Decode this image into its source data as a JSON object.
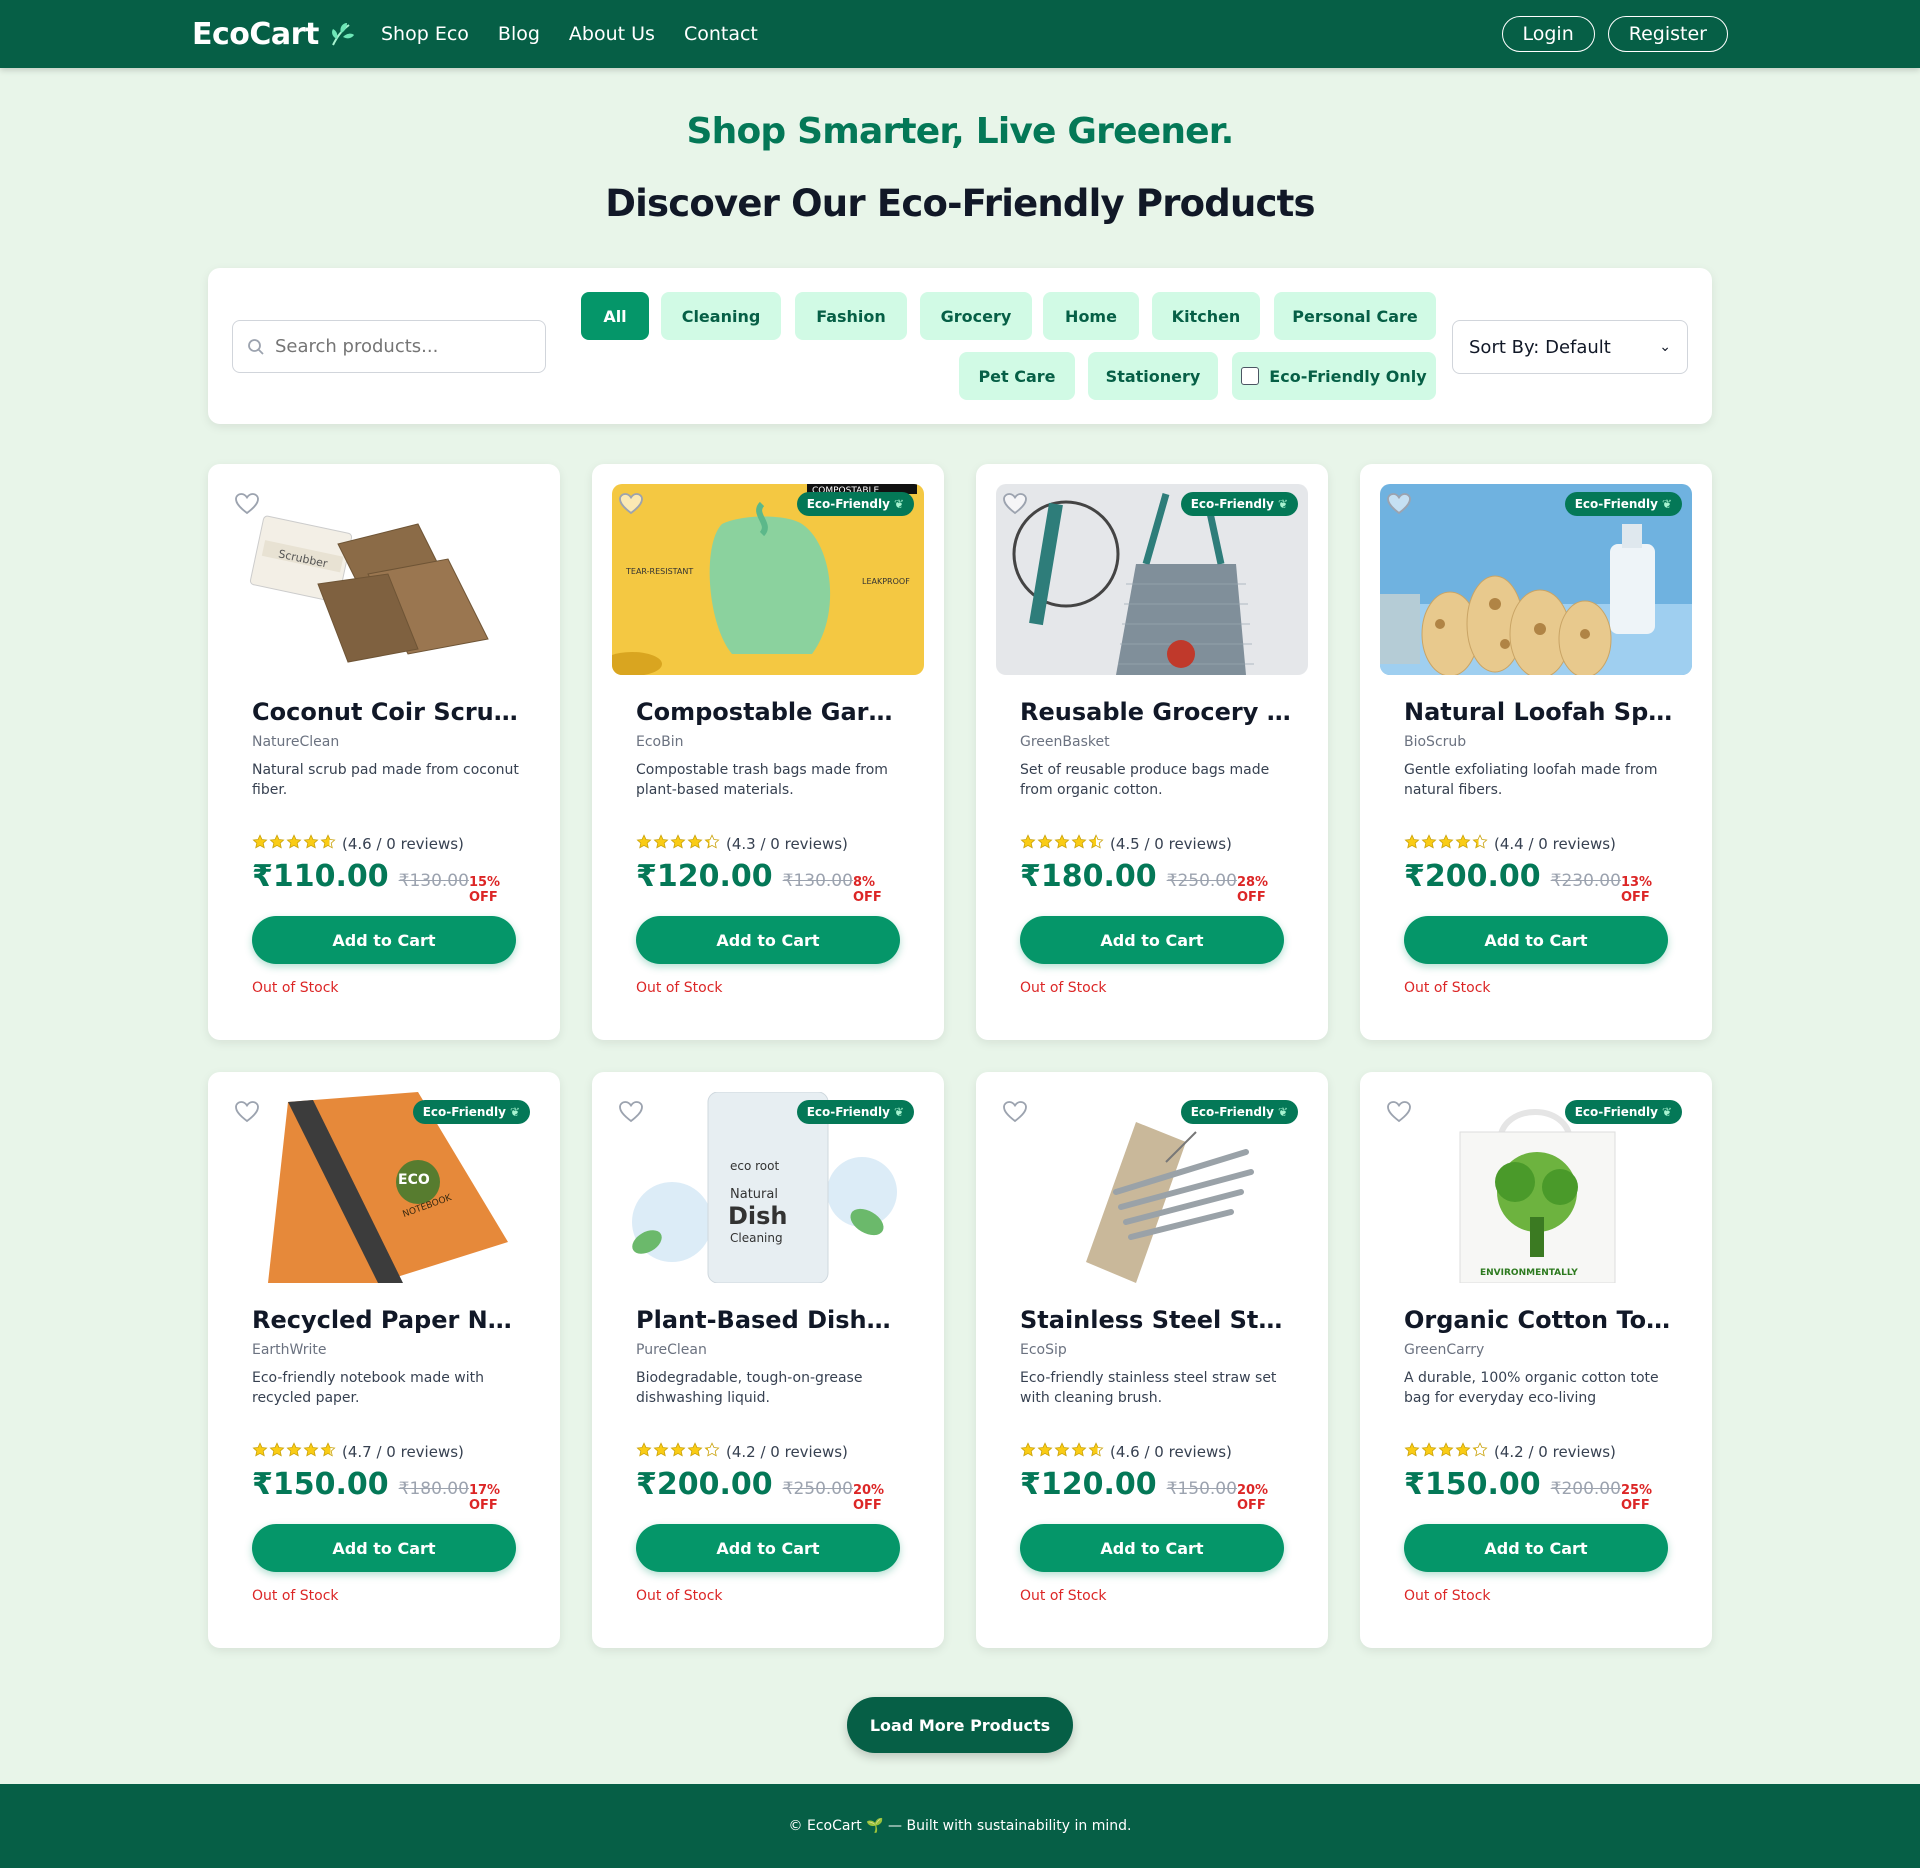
{
  "header": {
    "brand": "EcoCart",
    "nav": [
      "Shop Eco",
      "Blog",
      "About Us",
      "Contact"
    ],
    "login": "Login",
    "register": "Register"
  },
  "hero": {
    "tagline": "Shop Smarter, Live Greener.",
    "title": "Discover Our Eco-Friendly Products"
  },
  "filters": {
    "search_placeholder": "Search products...",
    "categories": [
      "All",
      "Cleaning",
      "Fashion",
      "Grocery",
      "Home",
      "Kitchen",
      "Personal Care",
      "Pet Care",
      "Stationery"
    ],
    "active": "All",
    "eco_only_label": "Eco-Friendly Only",
    "sort": "Sort By: Default"
  },
  "badge_label": "Eco-Friendly",
  "add_to_cart": "Add to Cart",
  "stock_label": "Out of Stock",
  "products": [
    {
      "name": "Coconut Coir Scrub ...",
      "brand": "NatureClean",
      "desc": "Natural scrub pad made from coconut fiber.",
      "stars": 4.6,
      "rating": "(4.6 / 0 reviews)",
      "price": "₹110.00",
      "old": "₹130.00",
      "off": "15% OFF",
      "eco": false,
      "img": "scrub"
    },
    {
      "name": "Compostable Garb...",
      "brand": "EcoBin",
      "desc": "Compostable trash bags made from plant-based materials.",
      "stars": 4.3,
      "rating": "(4.3 / 0 reviews)",
      "price": "₹120.00",
      "old": "₹130.00",
      "off": "8% OFF",
      "eco": true,
      "img": "bag"
    },
    {
      "name": "Reusable Grocery M...",
      "brand": "GreenBasket",
      "desc": "Set of reusable produce bags made from organic cotton.",
      "stars": 4.5,
      "rating": "(4.5 / 0 reviews)",
      "price": "₹180.00",
      "old": "₹250.00",
      "off": "28% OFF",
      "eco": true,
      "img": "mesh"
    },
    {
      "name": "Natural Loofah Spon...",
      "brand": "BioScrub",
      "desc": "Gentle exfoliating loofah made from natural fibers.",
      "stars": 4.4,
      "rating": "(4.4 / 0 reviews)",
      "price": "₹200.00",
      "old": "₹230.00",
      "off": "13% OFF",
      "eco": true,
      "img": "loofah"
    },
    {
      "name": "Recycled Paper Not...",
      "brand": "EarthWrite",
      "desc": "Eco-friendly notebook made with recycled paper.",
      "stars": 4.7,
      "rating": "(4.7 / 0 reviews)",
      "price": "₹150.00",
      "old": "₹180.00",
      "off": "17% OFF",
      "eco": true,
      "img": "notebook"
    },
    {
      "name": "Plant-Based Dishw...",
      "brand": "PureClean",
      "desc": "Biodegradable, tough-on-grease dishwashing liquid.",
      "stars": 4.2,
      "rating": "(4.2 / 0 reviews)",
      "price": "₹200.00",
      "old": "₹250.00",
      "off": "20% OFF",
      "eco": true,
      "img": "dish"
    },
    {
      "name": "Stainless Steel Stra...",
      "brand": "EcoSip",
      "desc": "Eco-friendly stainless steel straw set with cleaning brush.",
      "stars": 4.6,
      "rating": "(4.6 / 0 reviews)",
      "price": "₹120.00",
      "old": "₹150.00",
      "off": "20% OFF",
      "eco": true,
      "img": "straw"
    },
    {
      "name": "Organic Cotton Tote...",
      "brand": "GreenCarry",
      "desc": "A durable, 100% organic cotton tote bag for everyday eco-living",
      "stars": 4.2,
      "rating": "(4.2 / 0 reviews)",
      "price": "₹150.00",
      "old": "₹200.00",
      "off": "25% OFF",
      "eco": true,
      "img": "tote"
    }
  ],
  "load_more": "Load More Products",
  "footer": "© EcoCart 🌱 — Built with sustainability in mind.",
  "colors": {
    "primary": "#065f46",
    "accent": "#059669",
    "chip": "#d1fae5",
    "bg": "#e8f5e9",
    "sale": "#dc2626"
  }
}
